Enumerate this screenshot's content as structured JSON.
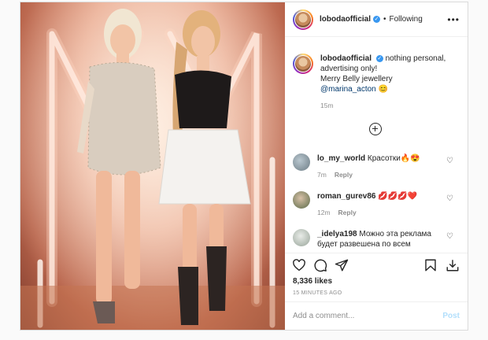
{
  "header": {
    "username": "lobodaofficial",
    "separator": "•",
    "follow_status": "Following",
    "more": "•••"
  },
  "caption": {
    "username": "lobodaofficial",
    "text_line1": "nothing personal,",
    "text_line2": "advertising only!",
    "text_line3": "Merry Belly jewellery",
    "mention": "@marina_acton",
    "emoji": "😊",
    "time": "15m"
  },
  "comments": [
    {
      "username": "lo_my_world",
      "text": "Красотки🔥😍",
      "time": "7m",
      "reply": "Reply"
    },
    {
      "username": "roman_gurev86",
      "text": "💋💋💋❤️",
      "time": "12m",
      "reply": "Reply"
    },
    {
      "username": "_idelya198",
      "text": "Можно эта реклама будет развешена по всем",
      "time": "",
      "reply": ""
    }
  ],
  "likes": "8,336 likes",
  "timestamp": "15 MINUTES AGO",
  "add_comment": {
    "placeholder": "Add a comment...",
    "post_label": "Post"
  },
  "icons": [
    "more-icon",
    "verified-icon",
    "heart-icon",
    "comment-icon",
    "share-icon",
    "bookmark-icon",
    "save-download-icon",
    "load-more-icon"
  ],
  "colors": {
    "verified": "#3897f0",
    "post_disabled": "#b2dffc",
    "muted": "#8e8e8e",
    "mention": "#00376b"
  }
}
